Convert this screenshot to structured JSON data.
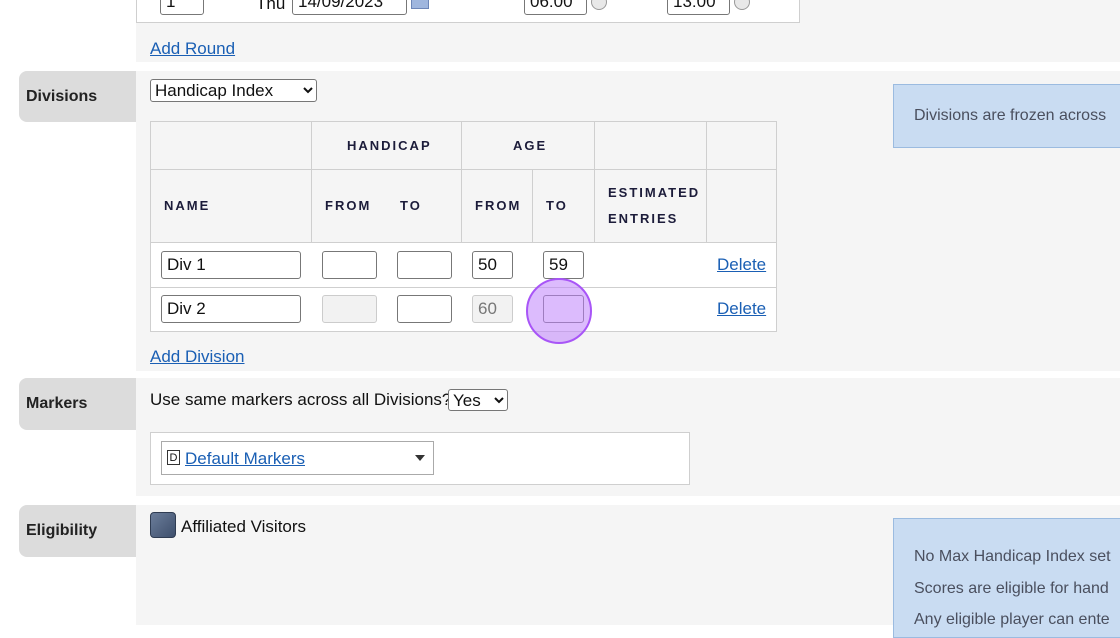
{
  "rounds": {
    "row": {
      "number": "1",
      "day": "Thu",
      "date": "14/09/2023",
      "start_time": "06:00",
      "end_time": "13:00"
    },
    "add_round_label": "Add Round"
  },
  "divisions": {
    "label": "Divisions",
    "type_selected": "Handicap Index",
    "headers": {
      "handicap": "HANDICAP",
      "age": "AGE",
      "name": "NAME",
      "from": "FROM",
      "to": "TO",
      "estimated": "ESTIMATED",
      "entries": "ENTRIES"
    },
    "rows": [
      {
        "name": "Div 1",
        "hcp_from": "",
        "hcp_to": "",
        "age_from": "50",
        "age_to": "59",
        "delete_label": "Delete"
      },
      {
        "name": "Div 2",
        "hcp_from": "",
        "hcp_to": "",
        "age_from": "60",
        "age_to": "",
        "delete_label": "Delete"
      }
    ],
    "add_division_label": "Add Division",
    "info_text": "Divisions are frozen across"
  },
  "markers": {
    "label": "Markers",
    "question": "Use same markers across all Divisions?",
    "answer_selected": "Yes",
    "default_badge": "D",
    "default_markers_label": "Default Markers"
  },
  "eligibility": {
    "label": "Eligibility",
    "affiliated_label": "Affiliated Visitors",
    "info_lines": [
      "No Max Handicap Index set",
      "Scores are eligible for hand",
      "Any eligible player can ente"
    ]
  },
  "colors": {
    "link": "#1a5fb4",
    "info_bg": "#c9dcf2",
    "cursor": "#a855f7"
  }
}
